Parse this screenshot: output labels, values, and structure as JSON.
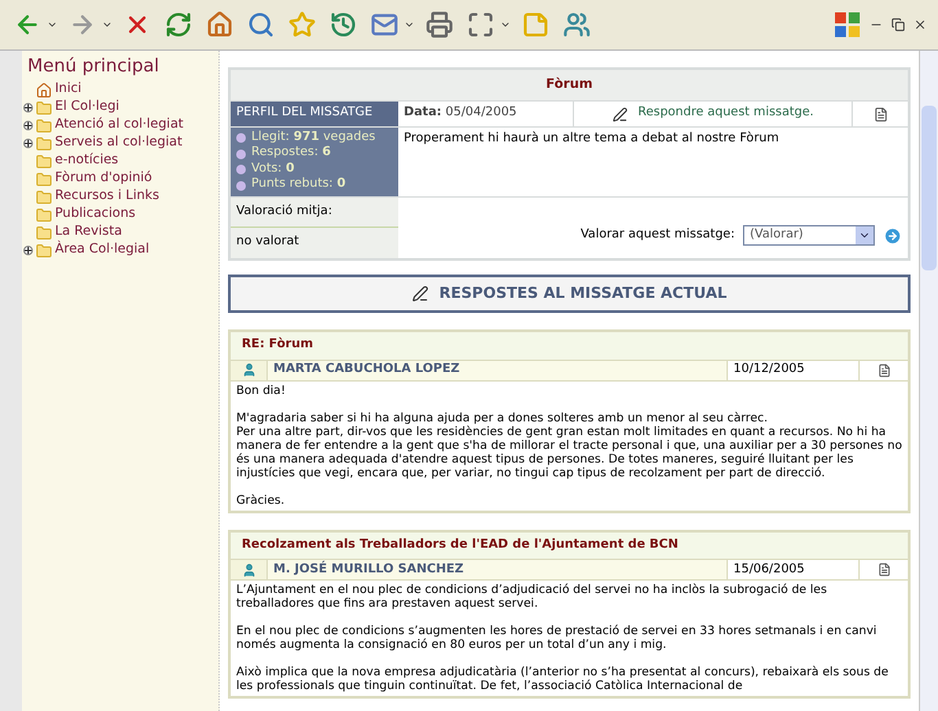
{
  "sidebar": {
    "title": "Menú principal",
    "items": [
      {
        "label": "Inici",
        "kind": "home",
        "expandable": false
      },
      {
        "label": "El Col·legi",
        "kind": "folder",
        "expandable": true
      },
      {
        "label": "Atenció al col·legiat",
        "kind": "folder",
        "expandable": true
      },
      {
        "label": "Serveis al col·legiat",
        "kind": "folder",
        "expandable": true
      },
      {
        "label": "e-notícies",
        "kind": "folder",
        "expandable": false
      },
      {
        "label": "Fòrum d'opinió",
        "kind": "folder",
        "expandable": false
      },
      {
        "label": "Recursos i Links",
        "kind": "folder",
        "expandable": false
      },
      {
        "label": "Publicacions",
        "kind": "folder",
        "expandable": false
      },
      {
        "label": "La Revista",
        "kind": "folder",
        "expandable": false
      },
      {
        "label": "Àrea Col·legial",
        "kind": "folder",
        "expandable": true
      }
    ]
  },
  "forum": {
    "title": "Fòrum",
    "profile_label": "PERFIL DEL MISSATGE",
    "date_label": "Data:",
    "date": "05/04/2005",
    "reply_link": "Respondre aquest missatge.",
    "message": "Properament hi haurà un altre tema a debat al nostre Fòrum",
    "stats": [
      "Llegit: **971** vegades",
      "Respostes: **6**",
      "Vots: **0**",
      "Punts rebuts: **0**"
    ],
    "rating_label": "Valoració mitja:",
    "rating": "no valorat",
    "rate_label": "Valorar aquest missatge:",
    "rate_select": "(Valorar)"
  },
  "replies_header": "RESPOSTES AL MISSATGE ACTUAL",
  "replies": [
    {
      "title": "RE: Fòrum",
      "author": "MARTA CABUCHOLA LOPEZ",
      "date": "10/12/2005",
      "paragraphs": [
        "Bon dia!",
        "M'agradaria saber si hi ha alguna ajuda per a dones solteres amb un menor al seu càrrec.\nPer una altre part, dir-vos que les residències de gent gran estan molt limitades en quant a recursos. No hi ha manera de fer entendre a la gent que s'ha de millorar el tracte personal i que, una auxiliar per a 30 persones no és una manera adequada d'atendre aquest tipus de persones. De totes maneres, seguiré lluitant per les injustícies que vegi, encara que, per variar, no tingui cap tipus de recolzament per part de direcció.",
        "Gràcies."
      ]
    },
    {
      "title": "Recolzament als Treballadors de l'EAD de l'Ajuntament de BCN",
      "author": "M. JOSÉ MURILLO SANCHEZ",
      "date": "15/06/2005",
      "paragraphs": [
        "L’Ajuntament en el nou plec de condicions d’adjudicació del servei no ha inclòs la subrogació de les treballadores que fins ara prestaven aquest servei.",
        "En el nou plec de condicions s’augmenten les hores de prestació de servei en 33 hores setmanals i en canvi només augmenta la consignació en 80 euros per un total d’un any i mig.",
        "Això implica que la nova empresa adjudicatària (l’anterior no s’ha presentat al concurs), rebaixarà els sous de les professionals que tinguin continuïtat. De fet, l’associació Catòlica Internacional de"
      ]
    }
  ]
}
